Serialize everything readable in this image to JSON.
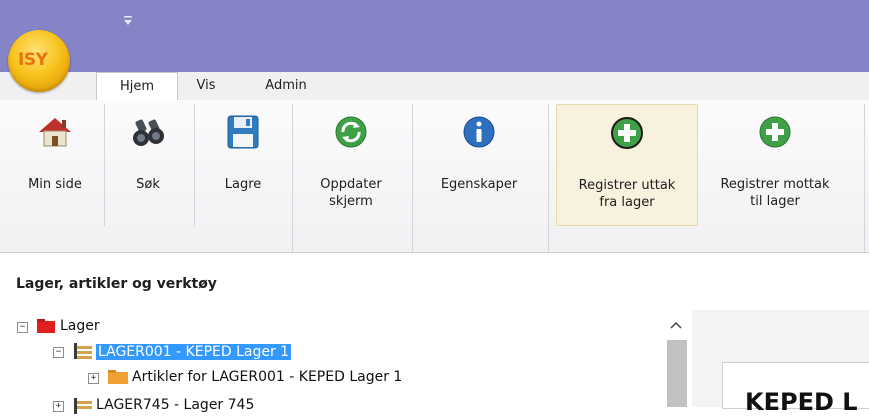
{
  "app": {
    "logo_text": "ISY"
  },
  "tabs": [
    {
      "label": "Hjem",
      "active": true
    },
    {
      "label": "Vis",
      "active": false
    },
    {
      "label": "Admin",
      "active": false
    }
  ],
  "ribbon": {
    "min_side": "Min side",
    "sok": "Søk",
    "lagre": "Lagre",
    "oppdater_line1": "Oppdater",
    "oppdater_line2": "skjerm",
    "egenskaper": "Egenskaper",
    "uttak_line1": "Registrer uttak",
    "uttak_line2": "fra lager",
    "mottak_line1": "Registrer mottak",
    "mottak_line2": "til lager"
  },
  "panel": {
    "title": "Lager, artikler og verktøy"
  },
  "tree": {
    "root": "Lager",
    "item1": "LAGER001 - KEPED Lager 1",
    "item1_child": "Artikler for LAGER001 - KEPED Lager 1",
    "item2": "LAGER745 - Lager 745"
  },
  "detail": {
    "title": "KEPED L"
  },
  "colors": {
    "titlebar": "#8484c6",
    "selection": "#3399ff",
    "orb": "#f7c31c"
  }
}
